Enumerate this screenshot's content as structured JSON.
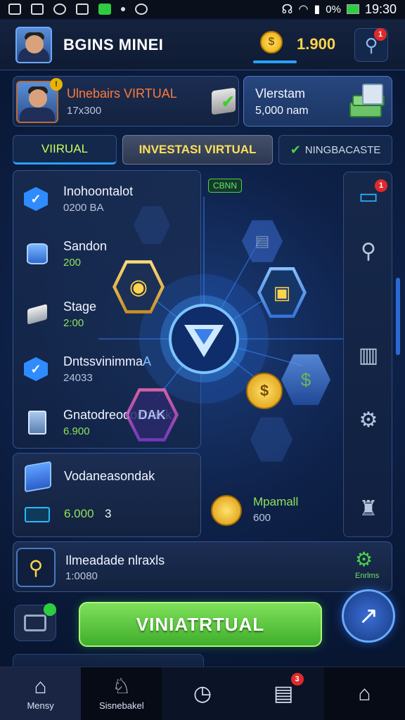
{
  "status_bar": {
    "battery": "0%",
    "time": "19:30"
  },
  "header": {
    "title": "BGINS MINEI",
    "balance": "1.900",
    "coin_symbol": "$",
    "notif_count": "1"
  },
  "profile_card": {
    "name": "Ulnebairs VIRTUAL",
    "amount": "17x300",
    "badge": "!"
  },
  "stats_card": {
    "title": "Vlerstam",
    "value": "5,000 nam"
  },
  "tabs": [
    {
      "label": "VIIRUAL"
    },
    {
      "label": "INVESTASI VIRTUAL"
    },
    {
      "label": "NINGBACASTE"
    }
  ],
  "assets": [
    {
      "title": "Inohoontalot",
      "value": "0200 BA",
      "green": false
    },
    {
      "title": "Sandon",
      "value": "200",
      "green": true
    },
    {
      "title": "Stage",
      "value": "2:00",
      "green": true
    },
    {
      "title": "Dntssvinimma",
      "value": "24033",
      "green": false
    },
    {
      "title": "Gnatodreodonhank",
      "value": "6.900",
      "green": true
    }
  ],
  "assets_decor": {
    "title_suffix": "A"
  },
  "center": {
    "badge": "CBNN",
    "hex_label": "DAK"
  },
  "lower_card": {
    "title": "Vodaneasondak",
    "value": "6.000",
    "count": "3"
  },
  "minicard": {
    "title": "Mpamall",
    "value": "600"
  },
  "reward_row": {
    "title": "Ilmeadade nlraxls",
    "value": "1:0080",
    "side_label": "Enrlms"
  },
  "activate_button": {
    "label": "VINIATRTUAL"
  },
  "sidebar": {
    "notif_count": "1"
  },
  "bottom_nav": [
    {
      "label": "Mensy"
    },
    {
      "label": "Sisnebakel"
    },
    {
      "label": ""
    },
    {
      "label": "",
      "badge": "3"
    },
    {
      "label": ""
    }
  ],
  "colors": {
    "accent": "#2aa0ff",
    "gold": "#ffd44a",
    "green": "#5ccf3a",
    "alert": "#e02a2a"
  }
}
